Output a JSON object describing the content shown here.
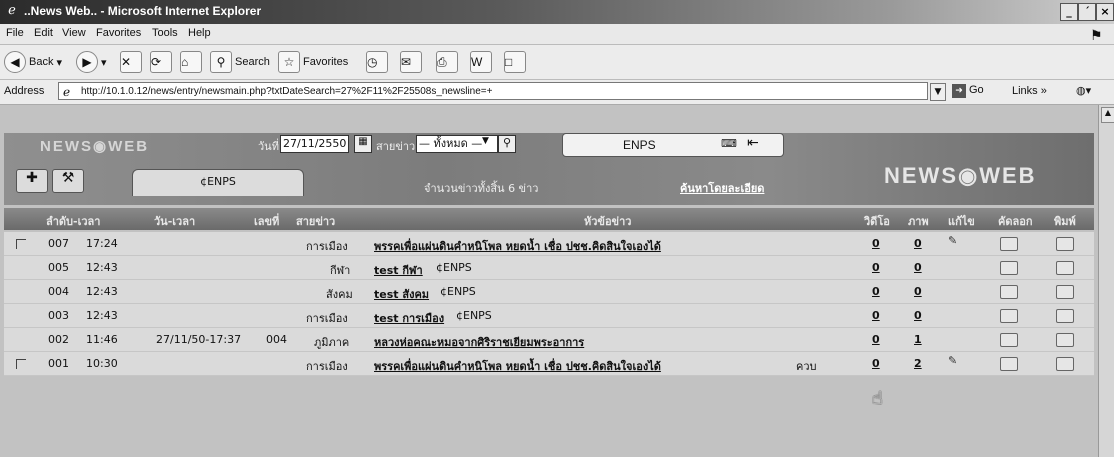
{
  "window": {
    "title": "..News Web.. - Microsoft Internet Explorer",
    "buttons": [
      "_",
      "´",
      "×"
    ]
  },
  "menu": [
    "File",
    "Edit",
    "View",
    "Favorites",
    "Tools",
    "Help"
  ],
  "toolbar": {
    "back": "Back",
    "search": "Search",
    "favorites": "Favorites"
  },
  "address": {
    "label": "Address",
    "url": "http://10.1.0.12/news/entry/newsmain.php?txtDateSearch=27%2F11%2F25508s_newsline=+",
    "go": "Go",
    "links": "Links »"
  },
  "header": {
    "logo_left": "NEWS◉WEB",
    "date_label": "วันที่",
    "date_value": "27/11/2550",
    "line_label": "สายข่าว",
    "line_value": "— ทั้งหมด —",
    "source": "ENPS",
    "tab_enps": "¢ENPS",
    "count": "จำนวนข่าวทั้งสิ้น 6 ข่าว",
    "adv_search": "ค้นหาโดยละเอียด",
    "logo_right": "NEWS◉WEB"
  },
  "columns": [
    "ลำดับ-เวลา",
    "วัน-เวลา",
    "เลขที่",
    "สายข่าว",
    "หัวข้อข่าว",
    "วิดีโอ",
    "ภาพ",
    "แก้ไข",
    "คัดลอก",
    "พิมพ์"
  ],
  "rows": [
    {
      "id": "007",
      "time": "17:24",
      "datetime": "",
      "no": "",
      "line": "การเมือง",
      "headline": "พรรคเพื่อแผ่นดินคำหนิโพล หยดน้ำ เชื่อ ปชช.คิดสินใจเองได้",
      "tag": "",
      "video": "0",
      "photo": "0"
    },
    {
      "id": "005",
      "time": "12:43",
      "datetime": "",
      "no": "",
      "line": "กีฬา",
      "headline": "test กีฬา",
      "tag": "¢ENPS",
      "video": "0",
      "photo": "0"
    },
    {
      "id": "004",
      "time": "12:43",
      "datetime": "",
      "no": "",
      "line": "สังคม",
      "headline": "test สังคม",
      "tag": "¢ENPS",
      "video": "0",
      "photo": "0"
    },
    {
      "id": "003",
      "time": "12:43",
      "datetime": "",
      "no": "",
      "line": "การเมือง",
      "headline": "test การเมือง",
      "tag": "¢ENPS",
      "video": "0",
      "photo": "0"
    },
    {
      "id": "002",
      "time": "11:46",
      "datetime": "27/11/50-17:37",
      "no": "004",
      "line": "ภูมิภาค",
      "headline": "หลวงห่อคณะหมอจากศิริราชเยียมพระอาการ",
      "tag": "",
      "video": "0",
      "photo": "1"
    },
    {
      "id": "001",
      "time": "10:30",
      "datetime": "",
      "no": "",
      "line": "การเมือง",
      "headline": "พรรคเพื่อแผ่นดินคำหนิโพล หยดน้ำ เชื่อ ปชช.คิดสินใจเองได้",
      "tag": "ควบ",
      "video": "0",
      "photo": "2"
    }
  ]
}
